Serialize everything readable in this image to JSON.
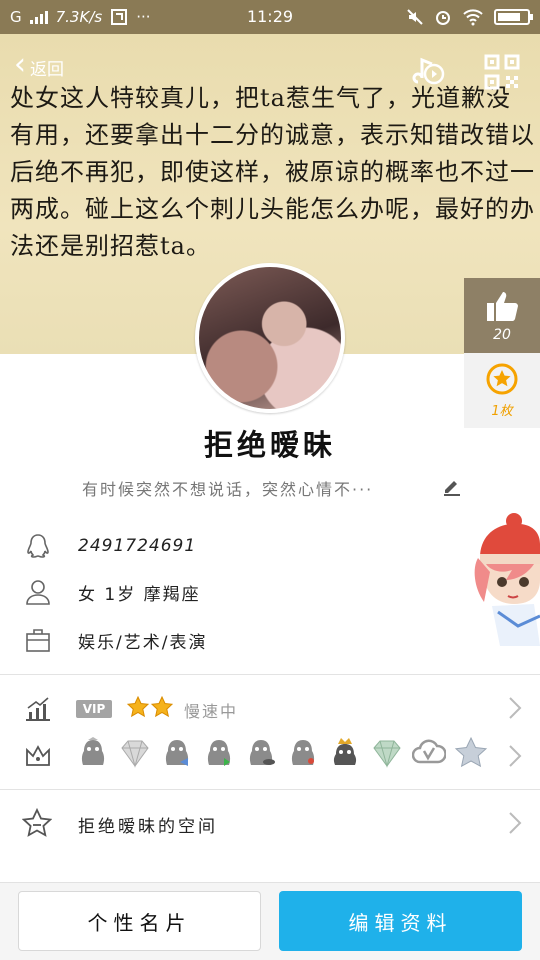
{
  "status_bar": {
    "carrier": "G",
    "speed": "7.3K/s",
    "time": "11:29"
  },
  "cover": {
    "back_label": "返回",
    "text": "处女这人特较真儿，把ta惹生气了，光道歉没有用，还要拿出十二分的诚意，表示知错改错以后绝不再犯，即使这样，被原谅的概率也不过一两成。碰上这么个刺儿头能怎么办呢，最好的办法还是别招惹ta。"
  },
  "like": {
    "count": "20"
  },
  "badge": {
    "count": "1枚"
  },
  "profile": {
    "nickname": "拒绝暧昧",
    "signature": "有时候突然不想说话，突然心情不···"
  },
  "info": {
    "qq_number": "2491724691",
    "personal": "女  1岁  摩羯座",
    "occupation": "娱乐/艺术/表演"
  },
  "level": {
    "vip_label": "VIP",
    "status": "慢速中"
  },
  "space": {
    "label": "拒绝暧昧的空间"
  },
  "bottom": {
    "card_label": "个性名片",
    "edit_label": "编辑资料"
  },
  "colors": {
    "accent": "#1fb1ea",
    "cover_bg": "#efe3bb",
    "like_panel": "#8e8066",
    "badge_gold": "#f6a300"
  },
  "icons": [
    "signal-icon",
    "screenshot-icon",
    "mute-icon",
    "alarm-icon",
    "wifi-icon",
    "battery-icon",
    "back-icon",
    "music-icon",
    "qr-code-icon",
    "thumbs-up-icon",
    "star-badge-icon",
    "edit-icon",
    "qq-penguin-icon",
    "person-icon",
    "briefcase-icon",
    "level-chart-icon",
    "crown-icon",
    "star-space-icon",
    "chevron-right-icon"
  ]
}
